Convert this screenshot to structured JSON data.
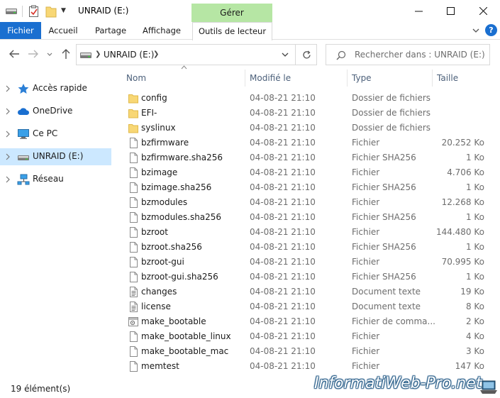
{
  "window": {
    "title": "UNRAID (E:)",
    "context_tab_group": "Gérer"
  },
  "ribbon": {
    "tabs": [
      {
        "label": "Fichier"
      },
      {
        "label": "Accueil"
      },
      {
        "label": "Partage"
      },
      {
        "label": "Affichage"
      },
      {
        "label": "Outils de lecteur"
      }
    ],
    "help_label": "?"
  },
  "address": {
    "path": "UNRAID (E:)"
  },
  "search": {
    "placeholder": "Rechercher dans : UNRAID (E:)"
  },
  "sidebar": {
    "items": [
      {
        "label": "Accès rapide",
        "icon": "star-icon"
      },
      {
        "label": "OneDrive",
        "icon": "cloud-icon"
      },
      {
        "label": "Ce PC",
        "icon": "computer-icon"
      },
      {
        "label": "UNRAID (E:)",
        "icon": "drive-icon",
        "selected": true
      },
      {
        "label": "Réseau",
        "icon": "network-icon"
      }
    ]
  },
  "columns": {
    "name": "Nom",
    "modified": "Modifié le",
    "type": "Type",
    "size": "Taille"
  },
  "files": [
    {
      "name": "config",
      "date": "04-08-21 21:10",
      "type": "Dossier de fichiers",
      "size": "",
      "icon": "folder-icon"
    },
    {
      "name": "EFI-",
      "date": "04-08-21 21:10",
      "type": "Dossier de fichiers",
      "size": "",
      "icon": "folder-icon"
    },
    {
      "name": "syslinux",
      "date": "04-08-21 21:10",
      "type": "Dossier de fichiers",
      "size": "",
      "icon": "folder-icon"
    },
    {
      "name": "bzfirmware",
      "date": "04-08-21 21:10",
      "type": "Fichier",
      "size": "20.252 Ko",
      "icon": "file-icon"
    },
    {
      "name": "bzfirmware.sha256",
      "date": "04-08-21 21:10",
      "type": "Fichier SHA256",
      "size": "1 Ko",
      "icon": "file-icon"
    },
    {
      "name": "bzimage",
      "date": "04-08-21 21:10",
      "type": "Fichier",
      "size": "4.706 Ko",
      "icon": "file-icon"
    },
    {
      "name": "bzimage.sha256",
      "date": "04-08-21 21:10",
      "type": "Fichier SHA256",
      "size": "1 Ko",
      "icon": "file-icon"
    },
    {
      "name": "bzmodules",
      "date": "04-08-21 21:10",
      "type": "Fichier",
      "size": "12.268 Ko",
      "icon": "file-icon"
    },
    {
      "name": "bzmodules.sha256",
      "date": "04-08-21 21:10",
      "type": "Fichier SHA256",
      "size": "1 Ko",
      "icon": "file-icon"
    },
    {
      "name": "bzroot",
      "date": "04-08-21 21:10",
      "type": "Fichier",
      "size": "144.480 Ko",
      "icon": "file-icon"
    },
    {
      "name": "bzroot.sha256",
      "date": "04-08-21 21:10",
      "type": "Fichier SHA256",
      "size": "1 Ko",
      "icon": "file-icon"
    },
    {
      "name": "bzroot-gui",
      "date": "04-08-21 21:10",
      "type": "Fichier",
      "size": "70.995 Ko",
      "icon": "file-icon"
    },
    {
      "name": "bzroot-gui.sha256",
      "date": "04-08-21 21:10",
      "type": "Fichier SHA256",
      "size": "1 Ko",
      "icon": "file-icon"
    },
    {
      "name": "changes",
      "date": "04-08-21 21:10",
      "type": "Document texte",
      "size": "19 Ko",
      "icon": "text-file-icon"
    },
    {
      "name": "license",
      "date": "04-08-21 21:10",
      "type": "Document texte",
      "size": "8 Ko",
      "icon": "text-file-icon"
    },
    {
      "name": "make_bootable",
      "date": "04-08-21 21:10",
      "type": "Fichier de comma...",
      "size": "2 Ko",
      "icon": "batch-file-icon"
    },
    {
      "name": "make_bootable_linux",
      "date": "04-08-21 21:10",
      "type": "Fichier",
      "size": "4 Ko",
      "icon": "file-icon"
    },
    {
      "name": "make_bootable_mac",
      "date": "04-08-21 21:10",
      "type": "Fichier",
      "size": "3 Ko",
      "icon": "file-icon"
    },
    {
      "name": "memtest",
      "date": "04-08-21 21:10",
      "type": "Fichier",
      "size": "147 Ko",
      "icon": "file-icon"
    }
  ],
  "status": {
    "item_count": "19 élément(s)"
  },
  "watermark": "InformatiWeb-Pro.net",
  "colors": {
    "accent": "#1a6fd0",
    "context_tab": "#b6e6a4",
    "selection": "#cce8ff",
    "folder": "#f8d775",
    "header_text": "#4c607a"
  }
}
